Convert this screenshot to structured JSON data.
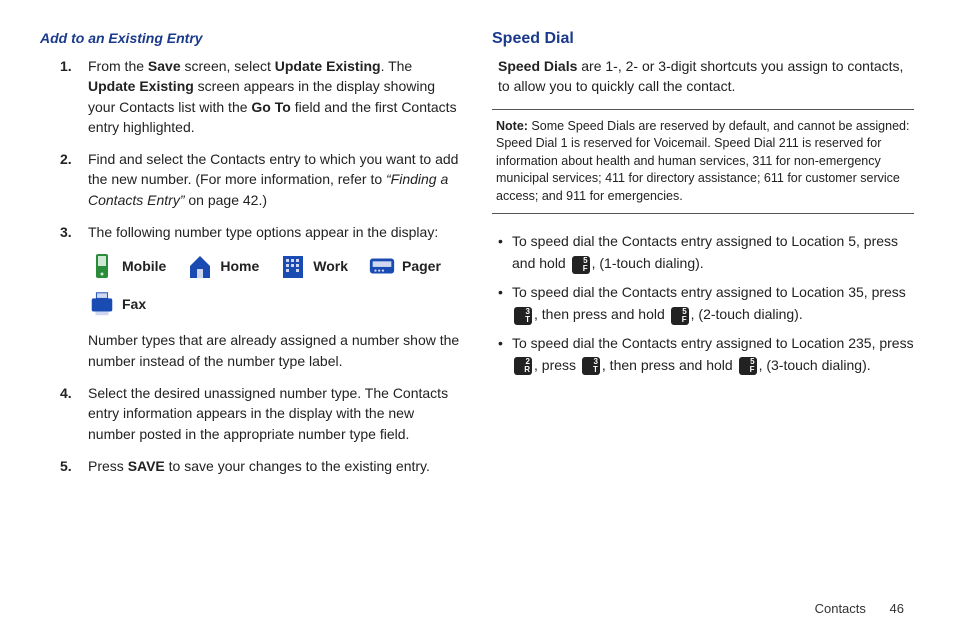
{
  "left": {
    "heading": "Add to an Existing Entry",
    "steps": [
      {
        "num": "1.",
        "parts": [
          {
            "t": "From the "
          },
          {
            "t": "Save",
            "b": 1
          },
          {
            "t": " screen, select "
          },
          {
            "t": "Update Existing",
            "b": 1
          },
          {
            "t": ". The "
          },
          {
            "t": "Update Existing",
            "b": 1
          },
          {
            "t": " screen appears in the display showing your Contacts list with the "
          },
          {
            "t": "Go To",
            "b": 1
          },
          {
            "t": " field and the first Contacts entry highlighted."
          }
        ]
      },
      {
        "num": "2.",
        "parts": [
          {
            "t": "Find and select the Contacts entry to which you want to add the new number. (For more information, refer to "
          },
          {
            "t": "“Finding a Contacts Entry”",
            "i": 1
          },
          {
            "t": "  on page 42.)"
          }
        ]
      },
      {
        "num": "3.",
        "parts": [
          {
            "t": "The following number type options appear in the display:"
          }
        ],
        "icons": [
          {
            "name": "mobile-icon",
            "label": "Mobile"
          },
          {
            "name": "home-icon",
            "label": "Home"
          },
          {
            "name": "work-icon",
            "label": "Work"
          },
          {
            "name": "pager-icon",
            "label": "Pager"
          },
          {
            "name": "fax-icon",
            "label": "Fax"
          }
        ],
        "after": "Number types that are already assigned a number show the number instead of the number type label."
      },
      {
        "num": "4.",
        "parts": [
          {
            "t": "Select the desired unassigned number type. The Contacts entry information appears in the display with the new number posted in the appropriate number type field."
          }
        ]
      },
      {
        "num": "5.",
        "parts": [
          {
            "t": "Press "
          },
          {
            "t": "SAVE",
            "b": 1
          },
          {
            "t": " to save your changes to the existing entry."
          }
        ]
      }
    ]
  },
  "right": {
    "heading": "Speed Dial",
    "intro_parts": [
      {
        "t": "Speed Dials",
        "b": 1
      },
      {
        "t": " are 1-, 2- or 3-digit shortcuts you assign to contacts, to allow you to quickly call the contact."
      }
    ],
    "note_label": "Note:",
    "note_text": " Some Speed Dials are reserved by default, and cannot be assigned: Speed Dial 1 is reserved for Voicemail. Speed Dial 211 is reserved for information about  health and human services,  311 for non-emergency municipal services; 411 for directory assistance; 611 for customer service access; and 911 for emergencies.",
    "bullets": [
      {
        "segs": [
          {
            "t": "To speed dial the Contacts entry assigned to Location 5, press and hold "
          },
          {
            "key": "5\nF"
          },
          {
            "t": ", (1-touch dialing)."
          }
        ]
      },
      {
        "segs": [
          {
            "t": "To speed dial the Contacts entry assigned to Location 35, press "
          },
          {
            "key": "3\nT"
          },
          {
            "t": ", then press and hold "
          },
          {
            "key": "5\nF"
          },
          {
            "t": ", (2-touch dialing)."
          }
        ]
      },
      {
        "segs": [
          {
            "t": "To speed dial the Contacts entry assigned to Location 235, press "
          },
          {
            "key": "2\nR"
          },
          {
            "t": ", press "
          },
          {
            "key": "3\nT"
          },
          {
            "t": ", then press and hold "
          },
          {
            "key": "5\nF"
          },
          {
            "t": ", (3-touch dialing)."
          }
        ]
      }
    ]
  },
  "footer": {
    "section": "Contacts",
    "page": "46"
  },
  "icons_svg": {
    "mobile-icon": "<svg width='24' height='28' viewBox='0 0 24 28'><rect x='6' y='2' width='12' height='24' rx='2' fill='#2a8b3a'/><rect x='8' y='4' width='8' height='10' fill='#cfe8d4'/><circle cx='12' cy='22' r='1.5' fill='#cfe8d4'/></svg>",
    "home-icon": "<svg width='28' height='28' viewBox='0 0 28 28'><path d='M4 14 L14 4 L24 14 L24 26 L4 26 Z' fill='#1a4bb3'/><rect x='11' y='17' width='6' height='9' fill='#cfd8f0'/></svg>",
    "work-icon": "<svg width='28' height='28' viewBox='0 0 28 28'><rect x='4' y='4' width='20' height='22' fill='#1a4bb3'/><g fill='#cfd8f0'><rect x='7' y='7' width='3' height='3'/><rect x='12' y='7' width='3' height='3'/><rect x='17' y='7' width='3' height='3'/><rect x='7' y='12' width='3' height='3'/><rect x='12' y='12' width='3' height='3'/><rect x='17' y='12' width='3' height='3'/><rect x='7' y='17' width='3' height='3'/><rect x='17' y='17' width='3' height='3'/></g></svg>",
    "pager-icon": "<svg width='30' height='24' viewBox='0 0 30 24'><rect x='2' y='4' width='26' height='16' rx='3' fill='#1a4bb3'/><rect x='5' y='7' width='20' height='6' fill='#cfd8f0'/><circle cx='8' cy='17' r='1.2' fill='#cfd8f0'/><circle cx='12' cy='17' r='1.2' fill='#cfd8f0'/><circle cx='16' cy='17' r='1.2' fill='#cfd8f0'/></svg>",
    "fax-icon": "<svg width='30' height='28' viewBox='0 0 30 28'><rect x='9' y='2' width='12' height='6' fill='#cfd8f0' stroke='#1a4bb3'/><rect x='4' y='8' width='22' height='14' rx='2' fill='#1a4bb3'/><rect x='8' y='22' width='14' height='4' fill='#cfd8f0'/></svg>"
  }
}
